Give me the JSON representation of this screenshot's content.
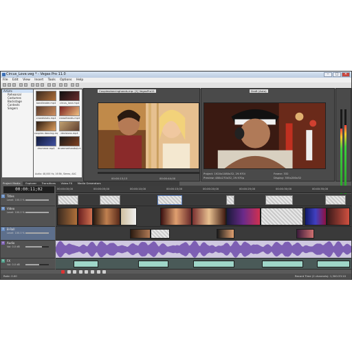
{
  "window": {
    "title": "Circus_Love.veg * - Vegas Pro 11.0",
    "minimize": "–",
    "maximize": "□",
    "close": "✕"
  },
  "menu": [
    "File",
    "Edit",
    "View",
    "Insert",
    "Tools",
    "Options",
    "Help"
  ],
  "explorer": {
    "tree": [
      "Artists",
      "Rehearsal",
      "Costumes",
      "Backstage",
      "Contests",
      "Singers"
    ],
    "media_items": [
      "bandleader.mp4",
      "circus_lane.mp4",
      "crowdshots.mp4",
      "crowdhands.mp4",
      "couples dancing.mp4",
      "decisions.mp4",
      "drummer.mp4",
      "drummerhandsA.mp4"
    ],
    "info": "Audio: 48,000 Hz, 16 Bit, Stereo, AAC"
  },
  "trimmer": {
    "filename": "Couplesdancinghands.mp4",
    "clip": "[1] VegasPro11",
    "time_in": "00:00:13;13",
    "time_out": "00:00:44;00"
  },
  "preview": {
    "mode": "Draft (Auto)",
    "project": "Project: 1920x1080x32, 29.970i",
    "preview_res": "Preview: 480x270x32, 29.970p",
    "frame": "Frame: 332",
    "display": "Display: 355x200x32"
  },
  "tabs": [
    "Project Media",
    "Explorer",
    "Transitions",
    "Video FX",
    "Media Generators"
  ],
  "timeline": {
    "timecode": "00:00:11;02",
    "ruler": [
      "00:00:00;00",
      "00:00:05;00",
      "00:00:10;00",
      "00:00:15;00",
      "00:00:20;00",
      "00:00:25;00",
      "00:00:30;00",
      "00:00:35;00"
    ]
  },
  "tracks": [
    {
      "num": "1",
      "name": "Titles",
      "level_label": "Level: 100.0 %",
      "level": 1.0
    },
    {
      "num": "2",
      "name": "Video",
      "level_label": "Level: 100.0 %",
      "level": 1.0
    },
    {
      "num": "3",
      "name": "B-Roll",
      "level_label": "Level: 100.0 %",
      "level": 1.0
    },
    {
      "num": "4",
      "name": "Audio",
      "level_label": "Vol: 0.0 dB",
      "level": 0.7
    },
    {
      "num": "5",
      "name": "FX",
      "level_label": "Vol: 0.0 dB",
      "level": 0.6
    }
  ],
  "status": {
    "rate": "Rate: 0.00",
    "complete": "Record Time (2 channels): 1,300:33:10"
  },
  "colors": {
    "accent": "#6a8fc4",
    "waveform": "#7d5fb3",
    "meter_green": "#3ad13a"
  }
}
